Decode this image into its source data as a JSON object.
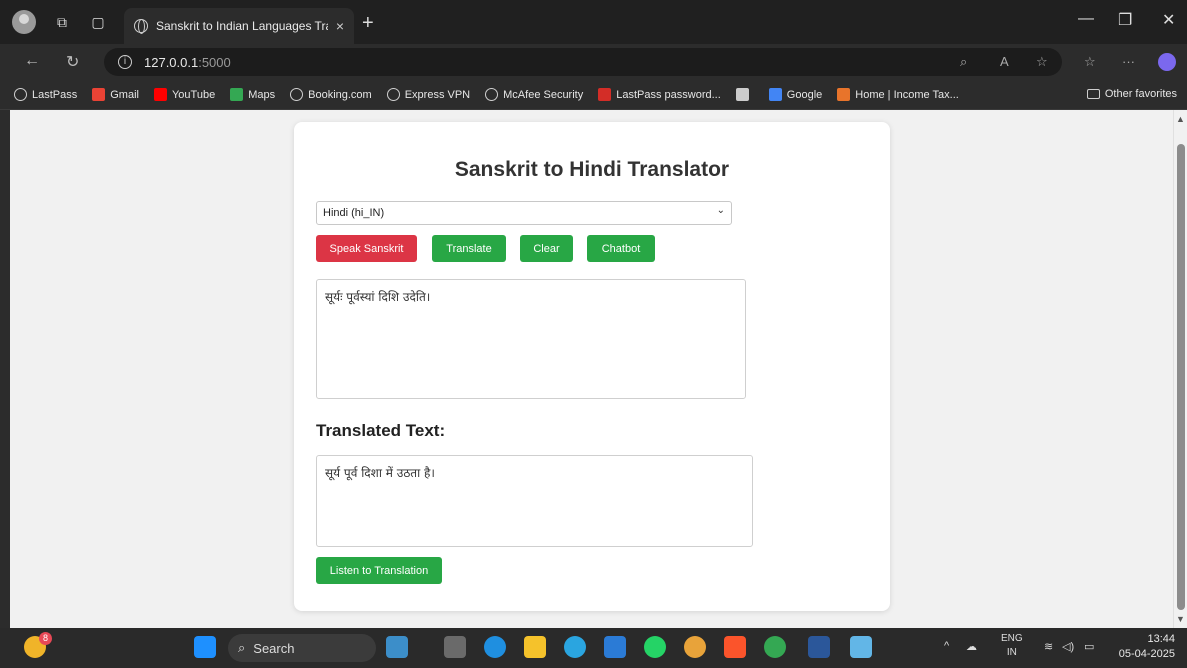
{
  "browser": {
    "tab_title": "Sanskrit to Indian Languages Tran",
    "tab_close": "×",
    "new_tab": "+",
    "url_host": "127.0.0.1",
    "url_port": ":5000",
    "bookmarks": [
      {
        "label": "LastPass",
        "icon": "globe-icon"
      },
      {
        "label": "Gmail",
        "icon": "gmail-icon",
        "color": "#ea4335"
      },
      {
        "label": "YouTube",
        "icon": "youtube-icon",
        "color": "#ff0000"
      },
      {
        "label": "Maps",
        "icon": "maps-icon",
        "color": "#34a853"
      },
      {
        "label": "Booking.com",
        "icon": "globe-icon"
      },
      {
        "label": "Express VPN",
        "icon": "globe-icon"
      },
      {
        "label": "McAfee Security",
        "icon": "globe-icon"
      },
      {
        "label": "LastPass password...",
        "icon": "lastpass-icon",
        "color": "#d32d27"
      },
      {
        "label": "",
        "icon": "edge-icon",
        "color": "#cccccc"
      },
      {
        "label": "Google",
        "icon": "google-icon",
        "color": "#4285f4"
      },
      {
        "label": "Home | Income Tax...",
        "icon": "incometax-icon",
        "color": "#e8742b"
      }
    ],
    "other_favorites": "Other favorites"
  },
  "page": {
    "title": "Sanskrit to Hindi Translator",
    "language_select": "Hindi (hi_IN)",
    "buttons": {
      "speak": "Speak Sanskrit",
      "translate": "Translate",
      "clear": "Clear",
      "chatbot": "Chatbot",
      "listen": "Listen to Translation"
    },
    "input_text": "सूर्यः पूर्वस्यां दिशि उदेति।",
    "translated_heading": "Translated Text:",
    "output_text": "सूर्य पूर्व दिशा में उठता है।",
    "colors": {
      "red": "#dc3545",
      "green": "#28a745"
    }
  },
  "taskbar": {
    "search_label": "Search",
    "weather_badge": "8",
    "lang_top": "ENG",
    "lang_bottom": "IN",
    "time": "13:44",
    "date": "05-04-2025"
  }
}
